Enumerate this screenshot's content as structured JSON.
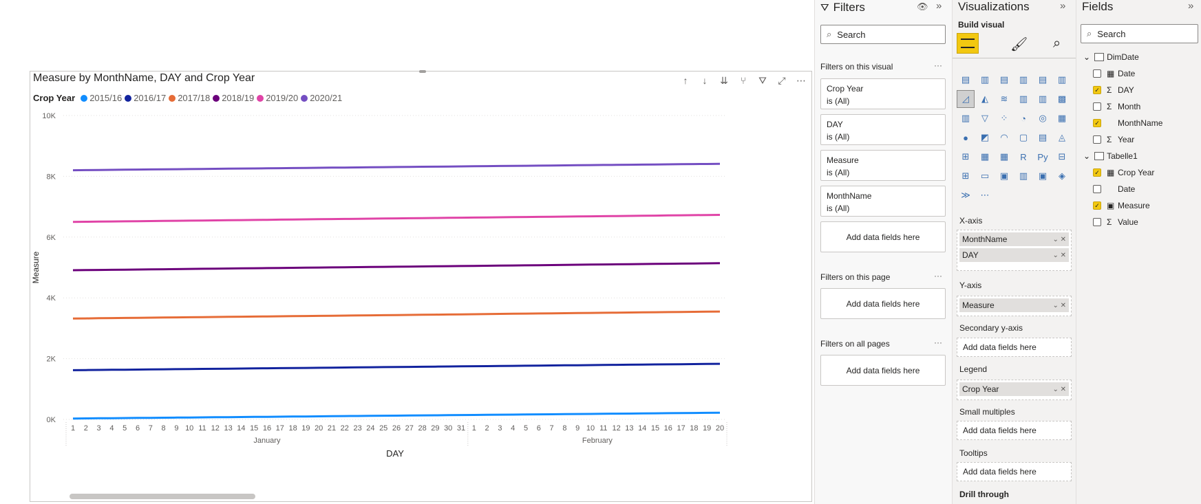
{
  "visual": {
    "title": "Measure by MonthName, DAY and Crop Year",
    "legend_title": "Crop Year"
  },
  "chart_data": {
    "type": "line",
    "title": "Measure by MonthName, DAY and Crop Year",
    "xlabel": "DAY",
    "ylabel": "Measure",
    "ylim": [
      0,
      10000
    ],
    "y_ticks": [
      "0K",
      "2K",
      "4K",
      "6K",
      "8K",
      "10K"
    ],
    "x_days": [
      "1",
      "2",
      "3",
      "4",
      "5",
      "6",
      "7",
      "8",
      "9",
      "10",
      "11",
      "12",
      "13",
      "14",
      "15",
      "16",
      "17",
      "18",
      "19",
      "20",
      "21",
      "22",
      "23",
      "24",
      "25",
      "26",
      "27",
      "28",
      "29",
      "30",
      "31",
      "1",
      "2",
      "3",
      "4",
      "5",
      "6",
      "7",
      "8",
      "9",
      "10",
      "11",
      "12",
      "13",
      "14",
      "15",
      "16",
      "17",
      "18",
      "19",
      "20"
    ],
    "x_groups": [
      "January",
      "February"
    ],
    "grid": true,
    "legend_position": "top-left",
    "series": [
      {
        "name": "2015/16",
        "color": "#118dff",
        "start": 30,
        "end": 220
      },
      {
        "name": "2016/17",
        "color": "#12239e",
        "start": 1620,
        "end": 1830
      },
      {
        "name": "2017/18",
        "color": "#e66c37",
        "start": 3320,
        "end": 3550
      },
      {
        "name": "2018/19",
        "color": "#6b007b",
        "start": 4910,
        "end": 5140
      },
      {
        "name": "2019/20",
        "color": "#e044a7",
        "start": 6500,
        "end": 6730
      },
      {
        "name": "2020/21",
        "color": "#744ec2",
        "start": 8200,
        "end": 8410
      }
    ]
  },
  "filters": {
    "title": "Filters",
    "search_placeholder": "Search",
    "on_visual_label": "Filters on this visual",
    "cards": [
      {
        "name": "Crop Year",
        "state": "is (All)"
      },
      {
        "name": "DAY",
        "state": "is (All)"
      },
      {
        "name": "Measure",
        "state": "is (All)"
      },
      {
        "name": "MonthName",
        "state": "is (All)"
      }
    ],
    "add_label": "Add data fields here",
    "on_page_label": "Filters on this page",
    "all_pages_label": "Filters on all pages",
    "more": "···"
  },
  "viz": {
    "title": "Visualizations",
    "build_label": "Build visual",
    "xaxis_label": "X-axis",
    "xaxis_fields": [
      "MonthName",
      "DAY"
    ],
    "yaxis_label": "Y-axis",
    "yaxis_fields": [
      "Measure"
    ],
    "secondary_label": "Secondary y-axis",
    "legend_label": "Legend",
    "legend_fields": [
      "Crop Year"
    ],
    "small_multiples_label": "Small multiples",
    "tooltips_label": "Tooltips",
    "drill_label": "Drill through",
    "add_label": "Add data fields here",
    "more": "···"
  },
  "fields": {
    "title": "Fields",
    "search_placeholder": "Search",
    "tables": [
      {
        "name": "DimDate",
        "items": [
          {
            "name": "Date",
            "checked": false,
            "kind": "hier"
          },
          {
            "name": "DAY",
            "checked": true,
            "kind": "sum"
          },
          {
            "name": "Month",
            "checked": false,
            "kind": "sum"
          },
          {
            "name": "MonthName",
            "checked": true,
            "kind": "text"
          },
          {
            "name": "Year",
            "checked": false,
            "kind": "sum"
          }
        ]
      },
      {
        "name": "Tabelle1",
        "items": [
          {
            "name": "Crop Year",
            "checked": true,
            "kind": "hier"
          },
          {
            "name": "Date",
            "checked": false,
            "kind": "text"
          },
          {
            "name": "Measure",
            "checked": true,
            "kind": "calc"
          },
          {
            "name": "Value",
            "checked": false,
            "kind": "sum"
          }
        ]
      }
    ]
  }
}
